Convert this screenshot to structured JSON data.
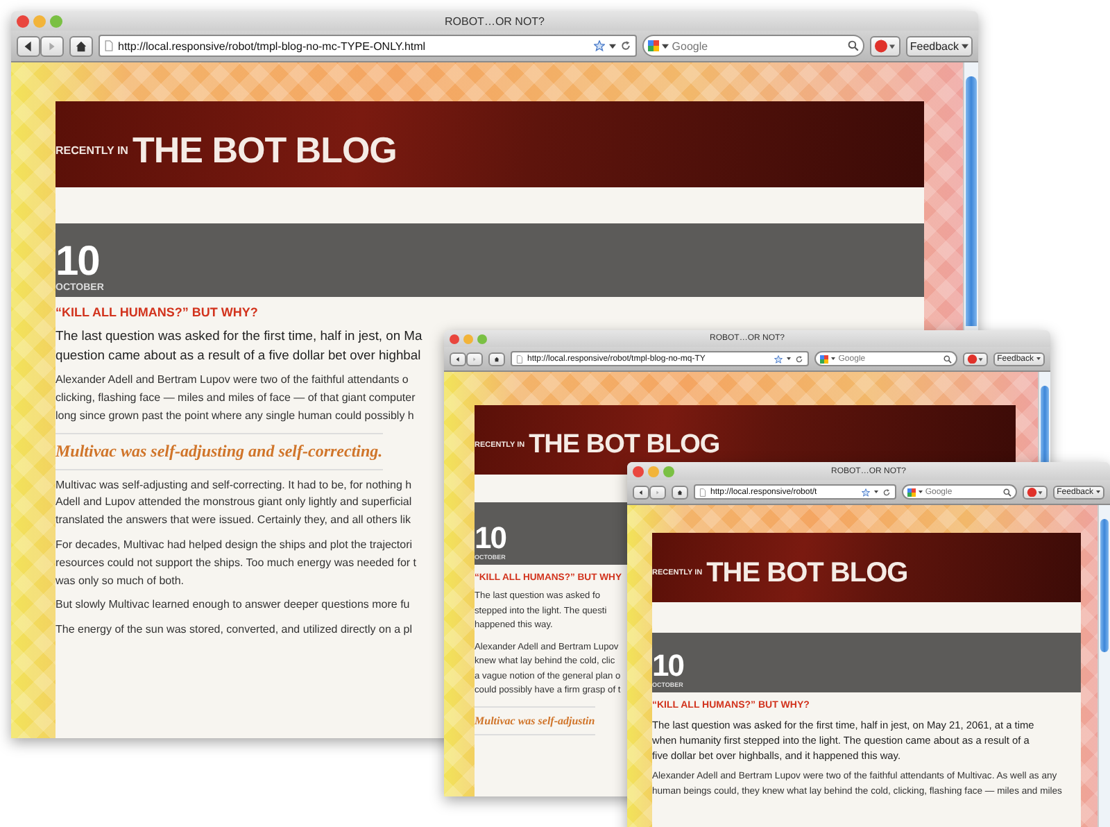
{
  "windows": [
    {
      "title": "ROBOT…OR NOT?",
      "url": "http://local.responsive/robot/tmpl-blog-no-mc-TYPE-ONLY.html",
      "search": {
        "placeholder": "Google"
      },
      "feedback": "Feedback",
      "kicker": "RECENTLY IN",
      "blog_title": "THE BOT BLOG",
      "day": "10",
      "month": "OCTOBER",
      "heading": "“KILL ALL HUMANS?” BUT WHY?",
      "blocks": [
        {
          "kind": "lead",
          "lines": [
            "The last question was asked for the first time, half in jest, on Ma",
            "question came about as a result of a five dollar bet over highbal"
          ]
        },
        {
          "kind": "paragraph",
          "lines": [
            "Alexander Adell and Bertram Lupov were two of the faithful attendants o",
            "clicking, flashing face — miles and miles of face — of that giant computer",
            "long since grown past the point where any single human could possibly h"
          ]
        },
        {
          "kind": "subheading",
          "lines": [
            "Multivac was self-adjusting and self-correcting."
          ]
        },
        {
          "kind": "paragraph",
          "lines": [
            "Multivac was self-adjusting and self-correcting. It had to be, for nothing h",
            "Adell and Lupov attended the monstrous giant only lightly and superficial",
            "translated the answers that were issued. Certainly they, and all others lik"
          ]
        },
        {
          "kind": "paragraph",
          "lines": [
            "For decades, Multivac had helped design the ships and plot the trajectori",
            "resources could not support the ships. Too much energy was needed for t",
            "was only so much of both."
          ]
        },
        {
          "kind": "paragraph",
          "lines": [
            "But slowly Multivac learned enough to answer deeper questions more fu"
          ]
        },
        {
          "kind": "paragraph",
          "lines": [
            "The energy of the sun was stored, converted, and utilized directly on a pl"
          ]
        }
      ]
    },
    {
      "title": "ROBOT…OR NOT?",
      "url": "http://local.responsive/robot/tmpl-blog-no-mq-TY",
      "search": {
        "placeholder": "Google"
      },
      "feedback": "Feedback",
      "kicker": "RECENTLY IN",
      "blog_title": "THE BOT BLOG",
      "day": "10",
      "month": "OCTOBER",
      "heading": "“KILL ALL HUMANS?” BUT WHY",
      "blocks": [
        {
          "kind": "paragraph",
          "lines": [
            "The last question was asked fo",
            "stepped into the light. The questi",
            "happened this way."
          ]
        },
        {
          "kind": "paragraph",
          "lines": [
            "Alexander Adell and Bertram Lupov",
            "knew what lay behind the cold, clic",
            "a vague notion of the general plan o",
            "could possibly have a firm grasp of t"
          ]
        },
        {
          "kind": "subheading",
          "lines": [
            "Multivac was self-adjustin"
          ]
        }
      ]
    },
    {
      "title": "ROBOT…OR NOT?",
      "url": "http://local.responsive/robot/t",
      "search": {
        "placeholder": "Google"
      },
      "feedback": "Feedback",
      "kicker": "RECENTLY IN",
      "blog_title": "THE BOT BLOG",
      "day": "10",
      "month": "OCTOBER",
      "heading": "“KILL ALL HUMANS?” BUT WHY?",
      "blocks": [
        {
          "kind": "lead",
          "lines": [
            "The last question was asked for the first time, half in jest, on May 21, 2061, at a time",
            "when humanity first stepped into the light. The question came about as a result of a",
            "five dollar bet over highballs, and it happened this way."
          ]
        },
        {
          "kind": "paragraph",
          "lines": [
            "Alexander Adell and Bertram Lupov were two of the faithful attendants of Multivac. As well as any",
            "human beings could, they knew what lay behind the cold, clicking, flashing face — miles and miles"
          ]
        }
      ]
    }
  ]
}
